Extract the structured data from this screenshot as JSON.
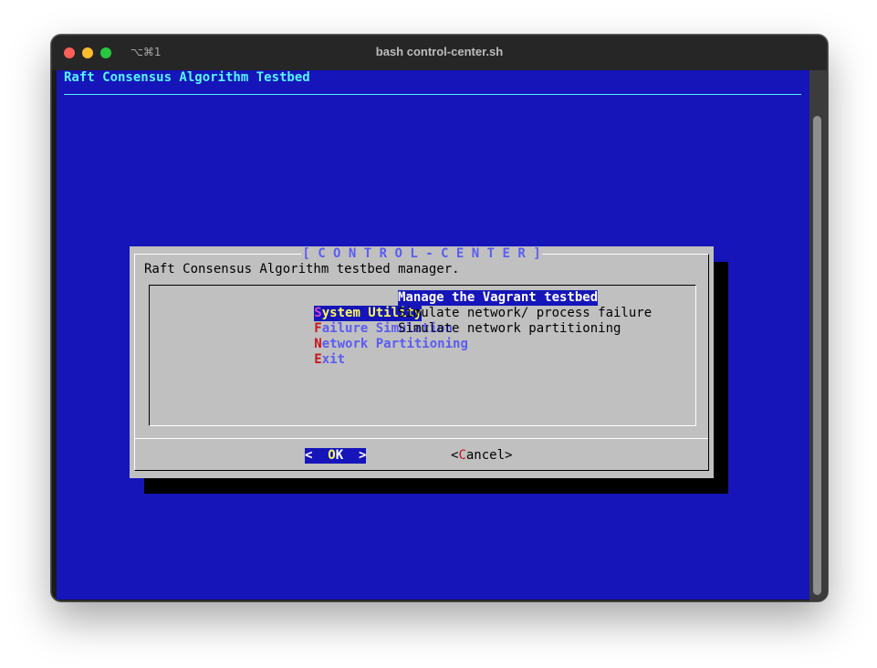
{
  "window": {
    "title": "bash control-center.sh",
    "shortcut": "⌥⌘1"
  },
  "terminal": {
    "backtitle": "Raft Consensus Algorithm Testbed"
  },
  "dialog": {
    "title": "[ C O N T R O L - C E N T E R ]",
    "description": "Raft Consensus Algorithm testbed manager.",
    "menu": [
      {
        "hotkey": "S",
        "rest": "ystem Utility",
        "description": "Manage the Vagrant testbed",
        "selected": true
      },
      {
        "hotkey": "F",
        "rest": "ailure Simulation",
        "description": "Simulate network/ process failure",
        "selected": false
      },
      {
        "hotkey": "N",
        "rest": "etwork Partitioning",
        "description": "Simulate network partitioning",
        "selected": false
      },
      {
        "hotkey": "E",
        "rest": "xit",
        "description": "",
        "selected": false
      }
    ],
    "buttons": {
      "ok": {
        "pre": "<  ",
        "key": "O",
        "post": "K  >"
      },
      "cancel": {
        "pre": "<",
        "key": "C",
        "post": "ancel>"
      }
    }
  },
  "colors": {
    "terminal_bg": "#1515b9",
    "backtitle": "#58f4ff",
    "dialog_bg": "#c0c0c0",
    "hotkey": "#c8141e",
    "tag_text": "#5c5cf2",
    "selected_tag_text": "#fffb60"
  }
}
